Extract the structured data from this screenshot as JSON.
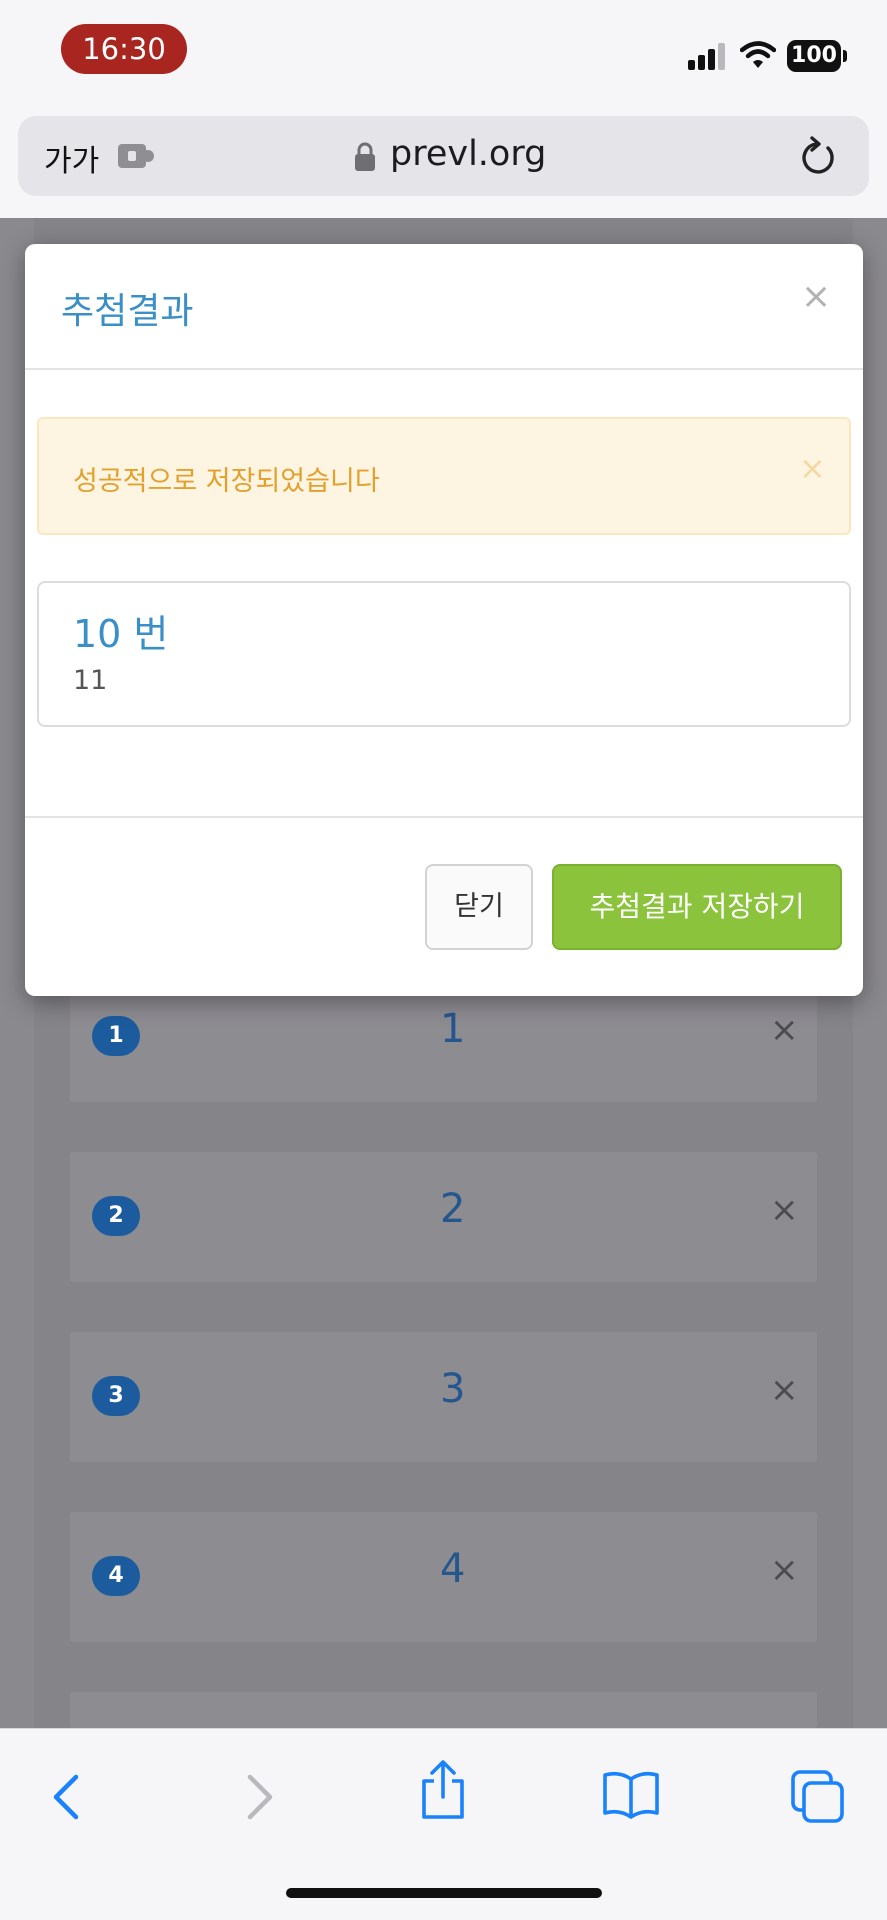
{
  "status_bar": {
    "time": "16:30",
    "battery": "100",
    "time_pill_color": "#a8261f"
  },
  "address_bar": {
    "text_size_label": "가가",
    "url": "prevl.org"
  },
  "modal": {
    "title": "추첨결과",
    "close_symbol": "×",
    "alert": {
      "message": "성공적으로 저장되었습니다",
      "close_symbol": "×",
      "color": "#e2a02c"
    },
    "result": {
      "title": "10 번",
      "detail": "11"
    },
    "buttons": {
      "close_label": "닫기",
      "save_label": "추첨결과 저장하기",
      "save_color": "#8bc43c"
    }
  },
  "background_list": {
    "items": [
      {
        "badge": "1",
        "value": "1",
        "remove": "×"
      },
      {
        "badge": "2",
        "value": "2",
        "remove": "×"
      },
      {
        "badge": "3",
        "value": "3",
        "remove": "×"
      },
      {
        "badge": "4",
        "value": "4",
        "remove": "×"
      }
    ]
  },
  "toolbar": {
    "icons": [
      "back-icon",
      "forward-icon",
      "share-icon",
      "bookmarks-icon",
      "tabs-icon"
    ],
    "accent_color": "#1a82fb"
  }
}
